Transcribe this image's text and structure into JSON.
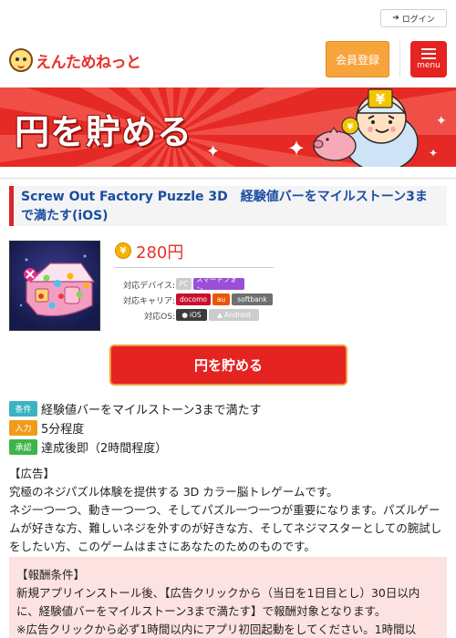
{
  "header": {
    "login_label": "ログイン",
    "brand": "えんためねっと",
    "register_label": "会員登録",
    "menu_label": "menu"
  },
  "banner": {
    "title": "円を貯める"
  },
  "offer": {
    "title": "Screw Out Factory Puzzle 3D　経験値バーをマイルストーン3まで満たす(iOS)",
    "reward": "280円",
    "coin_symbol": "¥",
    "specs": {
      "device_label": "対応デバイス:",
      "devices": [
        "PC",
        "スマートフォン"
      ],
      "carrier_label": "対応キャリア:",
      "carriers": [
        "docomo",
        "au",
        "softbank"
      ],
      "os_label": "対応OS:",
      "os": [
        "iOS",
        "Android"
      ]
    },
    "cta_label": "円を貯める",
    "conditions": [
      {
        "badge": "条件",
        "text": "経験値バーをマイルストーン3まで満たす",
        "color": "#3bb3c3"
      },
      {
        "badge": "入力",
        "text": "5分程度",
        "color": "#f29b1a"
      },
      {
        "badge": "承認",
        "text": "達成後即（2時間程度）",
        "color": "#3cb54a"
      }
    ]
  },
  "ad": {
    "heading": "【広告】",
    "lines": [
      "究極のネジパズル体験を提供する 3D カラー脳トレゲームです。",
      "ネジ一つ一つ、動き一つ一つ、そしてパズル一つ一つが重要になります。パズルゲームが好きな方、難しいネジを外すのが好きな方、そしてネジマスターとしての腕試しをしたい方、このゲームはまさにあなたのためのものです。"
    ]
  },
  "reward_conditions": {
    "heading": "【報酬条件】",
    "lines": [
      "新規アプリインストール後、【広告クリックから（当日を1日目とし）30日以内に、経験値バーをマイルストーン3まで満たす】で報酬対象となります。",
      "※広告クリックから必ず1時間以内にアプリ初回起動をしてください。1時間以"
    ]
  },
  "colors": {
    "brand_red": "#e52320",
    "register_orange": "#f7a43c",
    "title_blue": "#1b4ea3",
    "reward_red": "#e8312b",
    "reward_box_bg": "#fde2e2"
  }
}
